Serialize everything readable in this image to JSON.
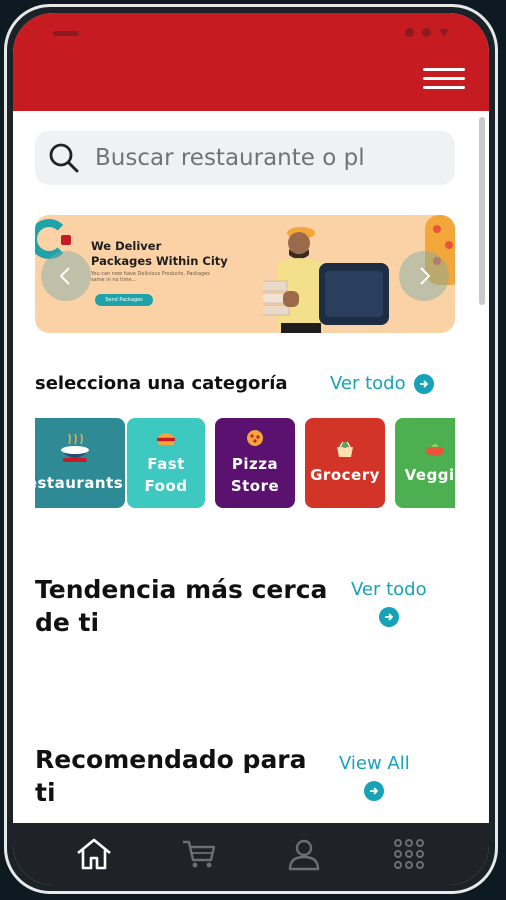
{
  "search": {
    "placeholder": "Buscar restaurante o pl"
  },
  "banner": {
    "title_line1": "We Deliver",
    "title_line2": "Packages Within City",
    "body": "You can now have Delicious Products, Packages same in no time...",
    "button": "Send Packages"
  },
  "categories_section": {
    "title": "selecciona una categoría",
    "see_all": "Ver todo",
    "items": [
      {
        "label": "estaurants",
        "color": "#2e8a95",
        "icon": "food-bowl-icon"
      },
      {
        "label": "Fast Food",
        "color": "#3ec9c0",
        "icon": "burger-icon"
      },
      {
        "label": "Pizza Store",
        "color": "#5a1170",
        "icon": "pizza-icon"
      },
      {
        "label": "Grocery",
        "color": "#d23427",
        "icon": "basket-icon"
      },
      {
        "label": "Veggie",
        "color": "#4caf50",
        "icon": "veggie-icon"
      }
    ]
  },
  "trending": {
    "title": "Tendencia más cerca de ti",
    "see_all": "Ver todo"
  },
  "recommended": {
    "title": "Recomendado para ti",
    "see_all": "View All"
  },
  "bottom_nav": [
    {
      "name": "home-icon",
      "active": true
    },
    {
      "name": "cart-icon",
      "active": false
    },
    {
      "name": "user-icon",
      "active": false
    },
    {
      "name": "grid-menu-icon",
      "active": false
    }
  ],
  "colors": {
    "brand_red": "#c71b22",
    "accent_teal": "#17a2b8",
    "nav_dark": "#1f2327"
  }
}
